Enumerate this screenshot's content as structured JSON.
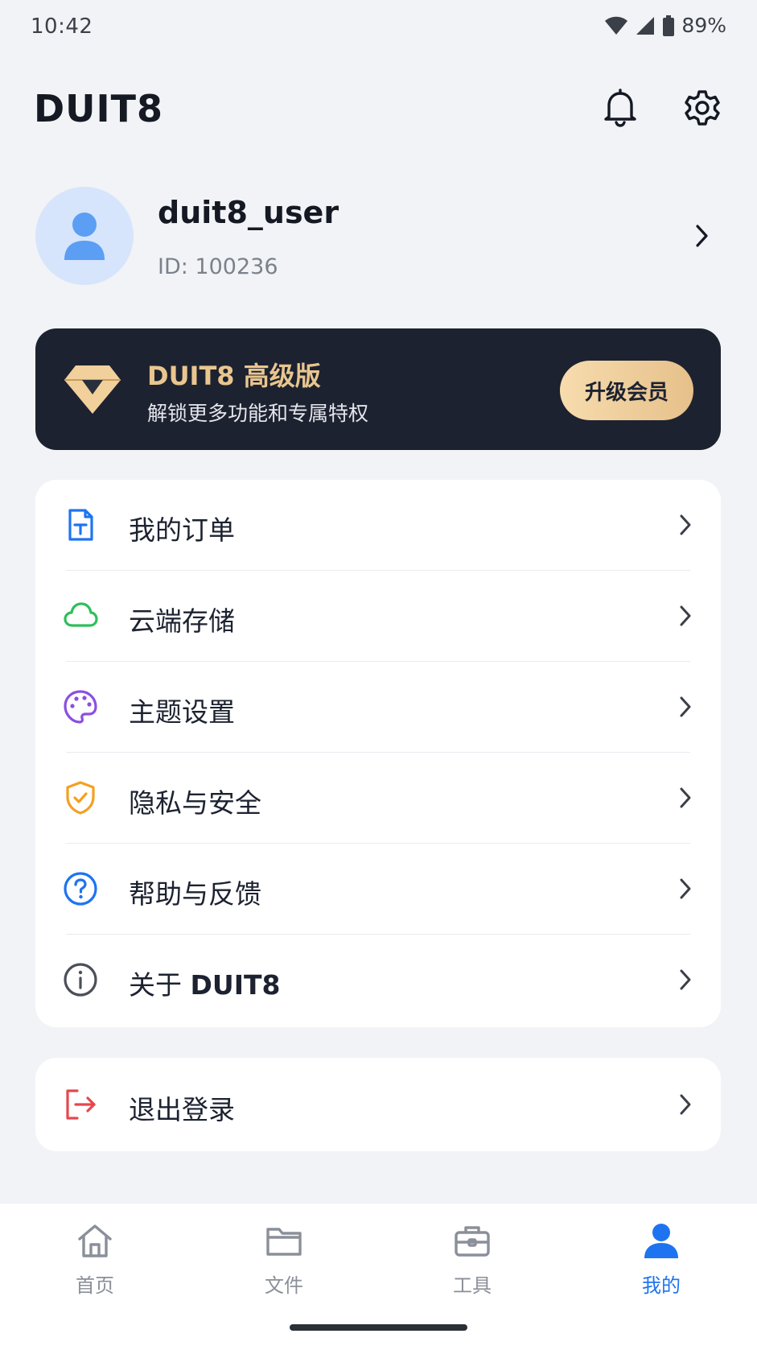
{
  "status_bar": {
    "time": "10:42",
    "battery": "89%"
  },
  "header": {
    "title": "DUIT8",
    "bell_icon": "bell-icon",
    "settings_icon": "gear-icon"
  },
  "profile": {
    "username": "duit8_user",
    "id": "ID: 100236"
  },
  "premium": {
    "title": "DUIT8 高级版",
    "subtitle": "解锁更多功能和专属特权",
    "button": "升级会员",
    "accent": "#e9c68f"
  },
  "menu": {
    "items": [
      {
        "label": "我的订单",
        "icon": "order-document-icon",
        "color": "#1e74f0"
      },
      {
        "label": "云端存储",
        "icon": "cloud-icon",
        "color": "#2fbe5b"
      },
      {
        "label": "主题设置",
        "icon": "palette-icon",
        "color": "#8b4fe0"
      },
      {
        "label": "隐私与安全",
        "icon": "shield-check-icon",
        "color": "#f4a020"
      },
      {
        "label": "帮助与反馈",
        "icon": "help-circle-icon",
        "color": "#1e74f0"
      },
      {
        "label_prefix": "关于 ",
        "label_brand": "DUIT8",
        "icon": "info-circle-icon",
        "color": "#4a4f58"
      }
    ]
  },
  "logout": {
    "label": "退出登录",
    "icon": "logout-icon",
    "color": "#e5484d"
  },
  "bottom_nav": {
    "items": [
      {
        "label": "首页",
        "icon": "home-icon"
      },
      {
        "label": "文件",
        "icon": "folder-icon"
      },
      {
        "label": "工具",
        "icon": "toolbox-icon"
      },
      {
        "label": "我的",
        "icon": "user-icon",
        "active": true
      }
    ],
    "active_color": "#1e74f0"
  }
}
